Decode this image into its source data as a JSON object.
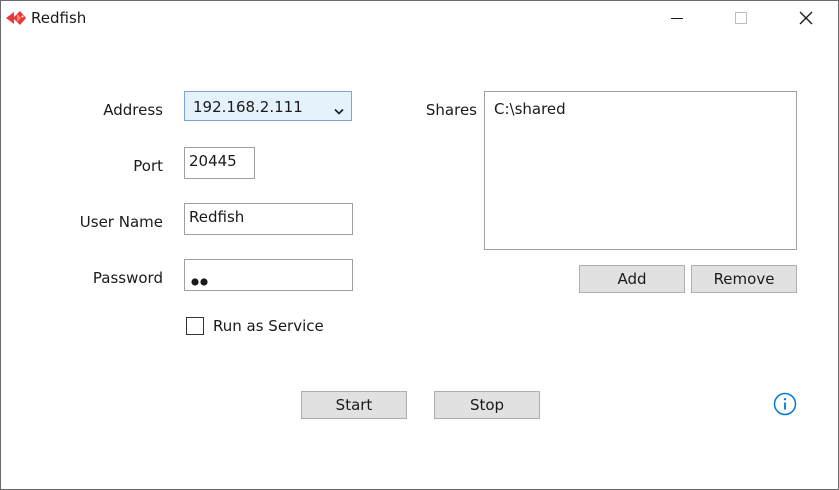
{
  "window": {
    "title": "Redfish",
    "icon": "redfish-logo-icon",
    "controls": [
      "minimize-icon",
      "maximize-icon",
      "close-icon"
    ]
  },
  "form": {
    "address_label": "Address",
    "address_value": "192.168.2.111",
    "port_label": "Port",
    "port_value": "20445",
    "username_label": "User Name",
    "username_value": "Redfish",
    "password_label": "Password",
    "password_mask": "••",
    "run_as_service_label": "Run as Service",
    "run_as_service_checked": false
  },
  "shares": {
    "label": "Shares",
    "items": [
      "C:\\shared"
    ],
    "add_label": "Add",
    "remove_label": "Remove"
  },
  "actions": {
    "start_label": "Start",
    "stop_label": "Stop",
    "info_icon": "info-icon"
  },
  "colors": {
    "accent": "#0078d7",
    "combo_bg": "#e5f1fb",
    "combo_border": "#7aa7d6",
    "button_bg": "#e1e1e1",
    "logo_red": "#e8383d"
  }
}
